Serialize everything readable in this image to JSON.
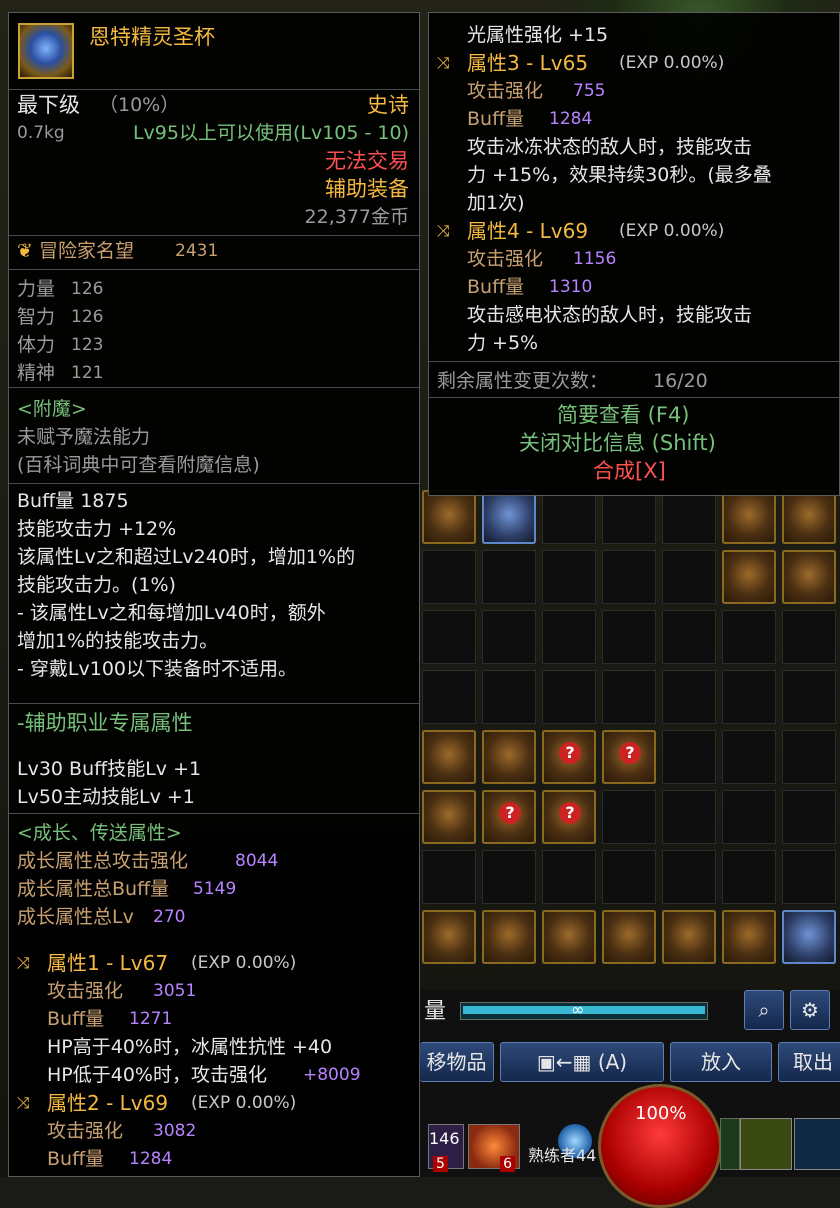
{
  "item": {
    "name": "恩特精灵圣杯",
    "grade": "最下级",
    "grade_pct": "（10%）",
    "rarity": "史诗",
    "weight": "0.7kg",
    "level_req": "Lv95以上可以使用(Lv105 - 10)",
    "trade": "无法交易",
    "slot": "辅助装备",
    "price": "22,377金币",
    "fame_label": "冒险家名望",
    "fame_value": "2431"
  },
  "stats": [
    {
      "label": "力量",
      "value": "126"
    },
    {
      "label": "智力",
      "value": "126"
    },
    {
      "label": "体力",
      "value": "123"
    },
    {
      "label": "精神",
      "value": "121"
    }
  ],
  "enchant": {
    "title": "<附魔>",
    "line1": "未赋予魔法能力",
    "line2": "(百科词典中可查看附魔信息)"
  },
  "effects": [
    "Buff量 1875",
    "技能攻击力 +12%",
    "该属性Lv之和超过Lv240时，增加1%的",
    "技能攻击力。(1%)",
    "- 该属性Lv之和每增加Lv40时，额外",
    "增加1%的技能攻击力。",
    "- 穿戴Lv100以下装备时不适用。"
  ],
  "support": {
    "title": "-辅助职业专属属性",
    "lines": [
      "Lv30 Buff技能Lv +1",
      "Lv50主动技能Lv +1"
    ]
  },
  "growth": {
    "title": "<成长、传送属性>",
    "rows": [
      {
        "label": "成长属性总攻击强化",
        "value": "8044"
      },
      {
        "label": "成长属性总Buff量",
        "value": "5149"
      },
      {
        "label": "成长属性总Lv",
        "value": "270"
      }
    ]
  },
  "attr1": {
    "header": "属性1 - Lv67",
    "exp": "(EXP 0.00%)",
    "atk_label": "攻击强化",
    "atk": "3051",
    "buff_label": "Buff量",
    "buff": "1271",
    "extra1": "HP高于40%时，冰属性抗性 +40",
    "extra2_label": "HP低于40%时，攻击强化",
    "extra2_value": "+8009"
  },
  "attr2": {
    "header": "属性2 - Lv69",
    "exp": "(EXP 0.00%)",
    "atk_label": "攻击强化",
    "atk": "3082",
    "buff_label": "Buff量",
    "buff": "1284"
  },
  "right": {
    "light": "光属性强化 +15",
    "attr3": {
      "header": "属性3 - Lv65",
      "exp": "(EXP 0.00%)",
      "atk_label": "攻击强化",
      "atk": "755",
      "buff_label": "Buff量",
      "buff": "1284",
      "desc1": "攻击冰冻状态的敌人时，技能攻击",
      "desc2": "力 +15%，效果持续30秒。(最多叠",
      "desc3": "加1次)"
    },
    "attr4": {
      "header": "属性4 - Lv69",
      "exp": "(EXP 0.00%)",
      "atk_label": "攻击强化",
      "atk": "1156",
      "buff_label": "Buff量",
      "buff": "1310",
      "desc1": "攻击感电状态的敌人时，技能攻击",
      "desc2": "力 +5%"
    },
    "remaining_label": "剩余属性变更次数：",
    "remaining_value": "16/20",
    "brief": "简要查看 (F4)",
    "close_compare": "关闭对比信息 (Shift)",
    "compose": "合成[X]"
  },
  "inventory": {
    "weight_label": "量",
    "bar_label": "∞",
    "move_label": "移物品",
    "transfer_label": "←",
    "transfer_key": "(A)",
    "put_label": "放入",
    "take_label": "取出",
    "hp_pct": "100%",
    "count": "146",
    "badge_5": "5",
    "badge_6": "6",
    "player_label": "熟练者44"
  },
  "colors": {
    "rarity": "#f5b840",
    "trade": "#ff5050",
    "accent": "#b784ff",
    "green": "#76c07a"
  }
}
